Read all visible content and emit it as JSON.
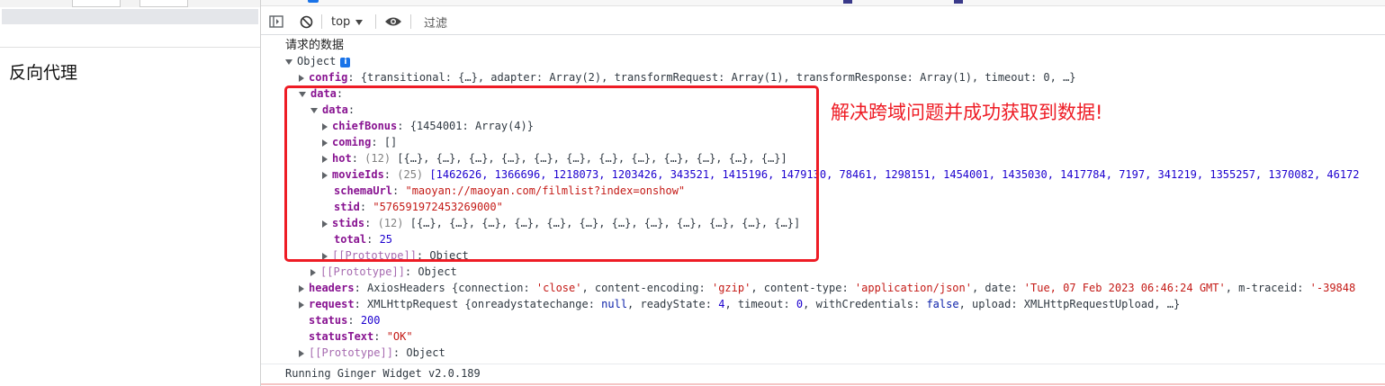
{
  "page": {
    "heading": "反向代理"
  },
  "toolbar": {
    "context": "top",
    "filter_placeholder": "过滤"
  },
  "console": {
    "log_label": "请求的数据",
    "object_label": "Object",
    "info_badge": "i",
    "config": {
      "key": "config",
      "preview": "{transitional: {…}, adapter: Array(2), transformRequest: Array(1), transformResponse: Array(1), timeout: 0, …}"
    },
    "data_outer_key": "data",
    "data_inner_key": "data",
    "chiefBonus": {
      "key": "chiefBonus",
      "preview": "{1454001: Array(4)}"
    },
    "coming": {
      "key": "coming",
      "preview": "[]"
    },
    "hot": {
      "key": "hot",
      "count": "(12)",
      "preview": "[{…}, {…}, {…}, {…}, {…}, {…}, {…}, {…}, {…}, {…}, {…}, {…}]"
    },
    "movieIds": {
      "key": "movieIds",
      "count": "(25)",
      "preview": "[1462626, 1366696, 1218073, 1203426, 343521, 1415196, 1479130, 78461, 1298151, 1454001, 1435030, 1417784, 7197, 341219, 1355257, 1370082, 46172"
    },
    "schemaUrl": {
      "key": "schemaUrl",
      "value": "\"maoyan://maoyan.com/filmlist?index=onshow\""
    },
    "stid": {
      "key": "stid",
      "value": "\"576591972453269000\""
    },
    "stids": {
      "key": "stids",
      "count": "(12)",
      "preview": "[{…}, {…}, {…}, {…}, {…}, {…}, {…}, {…}, {…}, {…}, {…}, {…}]"
    },
    "total": {
      "key": "total",
      "value": "25"
    },
    "prototype_key": "[[Prototype]]",
    "prototype_value": "Object",
    "headers": {
      "key": "headers",
      "type": "AxiosHeaders",
      "preview_parts": [
        {
          "t": "d",
          "v": "{connection: "
        },
        {
          "t": "s",
          "v": "'close'"
        },
        {
          "t": "d",
          "v": ", content-encoding: "
        },
        {
          "t": "s",
          "v": "'gzip'"
        },
        {
          "t": "d",
          "v": ", content-type: "
        },
        {
          "t": "s",
          "v": "'application/json'"
        },
        {
          "t": "d",
          "v": ", date: "
        },
        {
          "t": "s",
          "v": "'Tue, 07 Feb 2023 06:46:24 GMT'"
        },
        {
          "t": "d",
          "v": ", m-traceid: "
        },
        {
          "t": "s",
          "v": "'-39848"
        }
      ]
    },
    "request": {
      "key": "request",
      "type": "XMLHttpRequest",
      "preview_parts": [
        {
          "t": "d",
          "v": "{onreadystatechange: "
        },
        {
          "t": "b",
          "v": "null"
        },
        {
          "t": "d",
          "v": ", readyState: "
        },
        {
          "t": "n",
          "v": "4"
        },
        {
          "t": "d",
          "v": ", timeout: "
        },
        {
          "t": "n",
          "v": "0"
        },
        {
          "t": "d",
          "v": ", withCredentials: "
        },
        {
          "t": "b",
          "v": "false"
        },
        {
          "t": "d",
          "v": ", upload: XMLHttpRequestUpload, …}"
        }
      ]
    },
    "status": {
      "key": "status",
      "value": "200"
    },
    "statusText": {
      "key": "statusText",
      "value": "\"OK\""
    },
    "footer": "Running Ginger Widget v2.0.189"
  },
  "annotation": {
    "text": "解决跨域问题并成功获取到数据!",
    "color": "#ee1c25"
  }
}
